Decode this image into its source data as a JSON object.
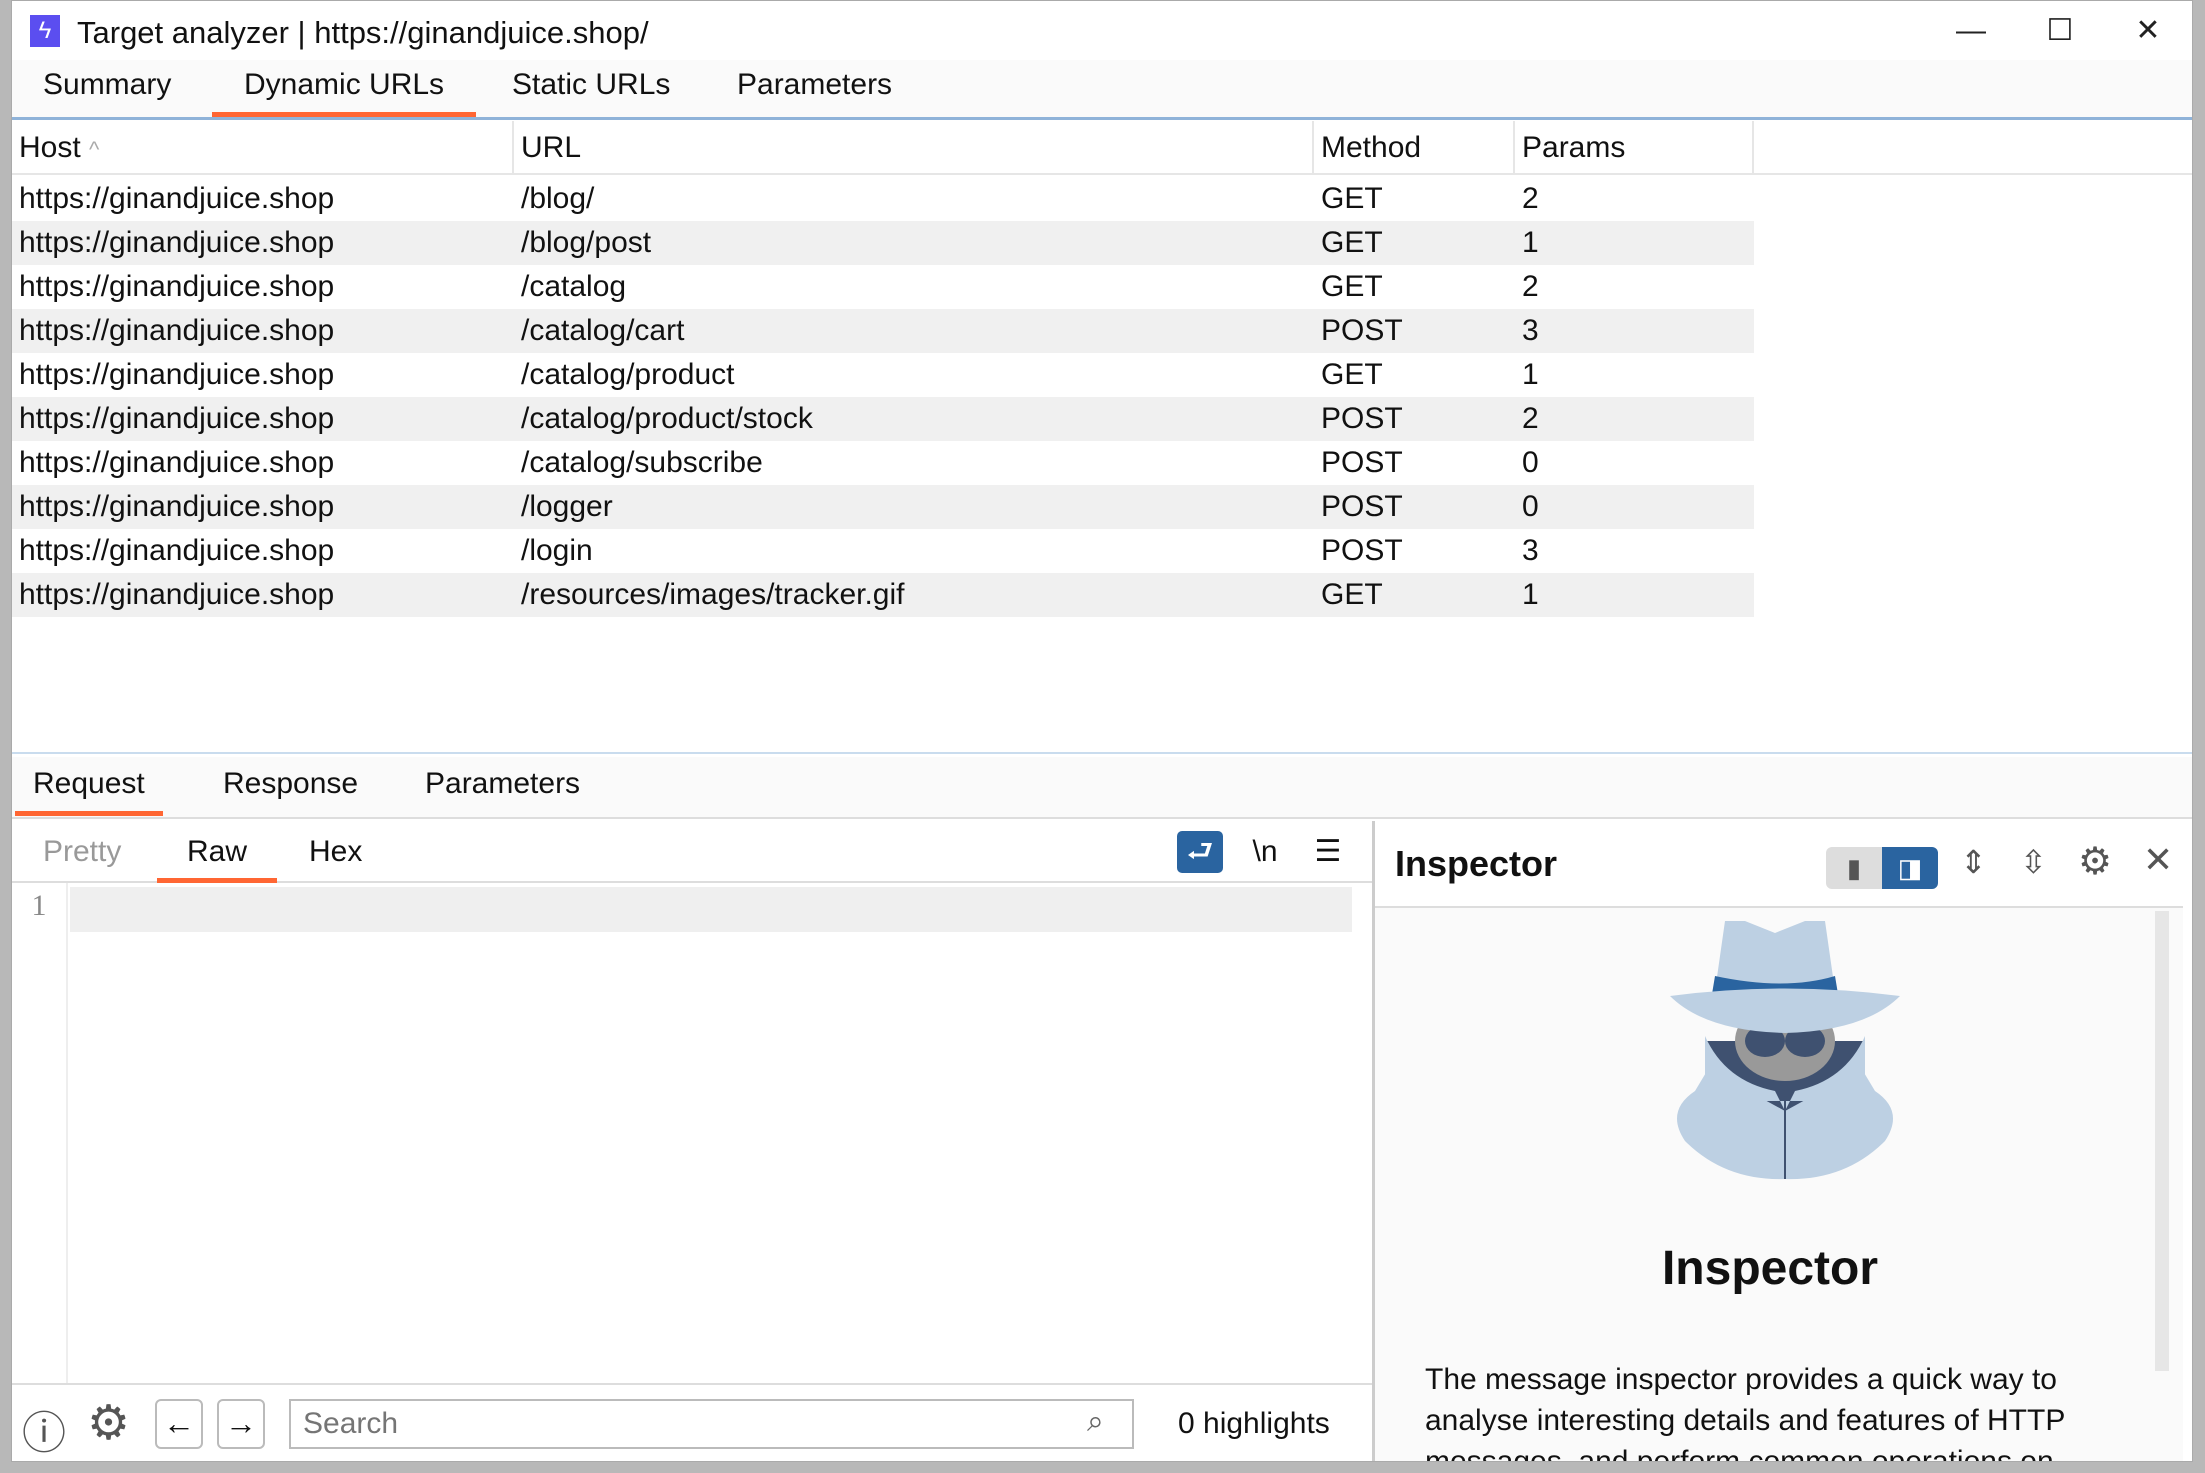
{
  "window": {
    "title": "Target analyzer | https://ginandjuice.shop/",
    "minimize": "—",
    "maximize": "☐",
    "close": "✕"
  },
  "tabs": [
    "Summary",
    "Dynamic URLs",
    "Static URLs",
    "Parameters"
  ],
  "table": {
    "columns": [
      "Host",
      "URL",
      "Method",
      "Params"
    ],
    "sort_indicator": "^",
    "rows": [
      [
        "https://ginandjuice.shop",
        "/blog/",
        "GET",
        "2"
      ],
      [
        "https://ginandjuice.shop",
        "/blog/post",
        "GET",
        "1"
      ],
      [
        "https://ginandjuice.shop",
        "/catalog",
        "GET",
        "2"
      ],
      [
        "https://ginandjuice.shop",
        "/catalog/cart",
        "POST",
        "3"
      ],
      [
        "https://ginandjuice.shop",
        "/catalog/product",
        "GET",
        "1"
      ],
      [
        "https://ginandjuice.shop",
        "/catalog/product/stock",
        "POST",
        "2"
      ],
      [
        "https://ginandjuice.shop",
        "/catalog/subscribe",
        "POST",
        "0"
      ],
      [
        "https://ginandjuice.shop",
        "/logger",
        "POST",
        "0"
      ],
      [
        "https://ginandjuice.shop",
        "/login",
        "POST",
        "3"
      ],
      [
        "https://ginandjuice.shop",
        "/resources/images/tracker.gif",
        "GET",
        "1"
      ]
    ]
  },
  "lower_tabs": [
    "Request",
    "Response",
    "Parameters"
  ],
  "editor_tabs": [
    "Pretty",
    "Raw",
    "Hex"
  ],
  "editor": {
    "newline_label": "\\n",
    "line_number": "1"
  },
  "inspector": {
    "title": "Inspector",
    "heading": "Inspector",
    "text": "The message inspector provides a quick way to analyse interesting details and features of HTTP messages, and perform common operations on"
  },
  "bottom": {
    "search_placeholder": "Search",
    "highlights": "0 highlights"
  },
  "colors": {
    "accent": "#ff6633",
    "blue": "#2a64a0"
  }
}
